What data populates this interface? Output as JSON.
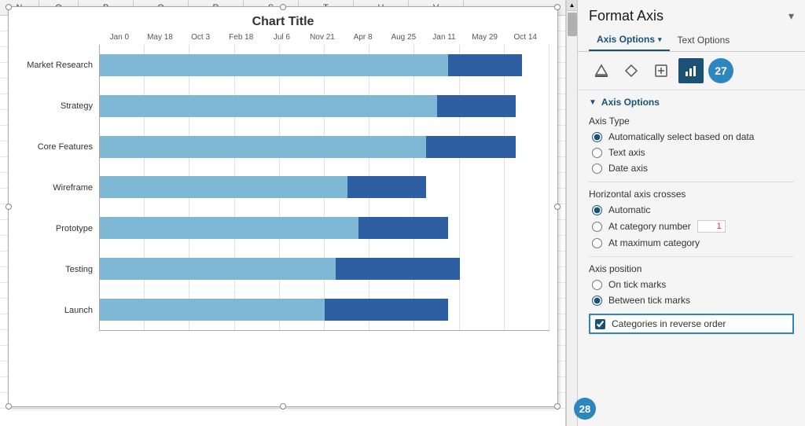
{
  "panel": {
    "title": "Format Axis",
    "close_label": "▾",
    "tabs": {
      "axis_options": "Axis Options",
      "text_options": "Text Options"
    },
    "icons": {
      "fill_icon": "fill",
      "shape_icon": "shape",
      "size_icon": "size",
      "bar_chart_icon": "bar-chart",
      "badge_number": "27"
    },
    "sections": {
      "axis_options": {
        "title": "Axis Options",
        "axis_type": {
          "label": "Axis Type",
          "options": [
            {
              "id": "auto",
              "label": "Automatically select based on data",
              "selected": true
            },
            {
              "id": "text",
              "label": "Text axis",
              "selected": false
            },
            {
              "id": "date",
              "label": "Date axis",
              "selected": false
            }
          ]
        },
        "horizontal_axis_crosses": {
          "label": "Horizontal axis crosses",
          "options": [
            {
              "id": "automatic",
              "label": "Automatic",
              "selected": true
            },
            {
              "id": "at_category",
              "label": "At category number",
              "selected": false,
              "value": "1"
            },
            {
              "id": "at_max",
              "label": "At maximum category",
              "selected": false
            }
          ]
        },
        "axis_position": {
          "label": "Axis position",
          "options": [
            {
              "id": "on_tick",
              "label": "On tick marks",
              "selected": false
            },
            {
              "id": "between_tick",
              "label": "Between tick marks",
              "selected": true
            }
          ]
        },
        "categories_reverse": {
          "label": "Categories in reverse order",
          "checked": true
        }
      }
    }
  },
  "chart": {
    "title": "Chart Title",
    "axis_labels": [
      "Jan 0",
      "May 18",
      "Oct 3",
      "Feb 18",
      "Jul 6",
      "Nov 21",
      "Apr 8",
      "Aug 25",
      "Jan 11",
      "May 29",
      "Oct 14"
    ],
    "series": [
      {
        "name": "Market Research",
        "light": 62,
        "dark": 13
      },
      {
        "name": "Strategy",
        "light": 60,
        "dark": 14
      },
      {
        "name": "Core Features",
        "light": 58,
        "dark": 16
      },
      {
        "name": "Wireframe",
        "light": 44,
        "dark": 14
      },
      {
        "name": "Prototype",
        "light": 46,
        "dark": 16
      },
      {
        "name": "Testing",
        "light": 42,
        "dark": 22
      },
      {
        "name": "Launch",
        "light": 40,
        "dark": 22
      }
    ]
  },
  "spreadsheet": {
    "columns": [
      "N",
      "O",
      "P",
      "Q",
      "R",
      "S",
      "T",
      "U",
      "V"
    ]
  },
  "bottom_badge": "28"
}
